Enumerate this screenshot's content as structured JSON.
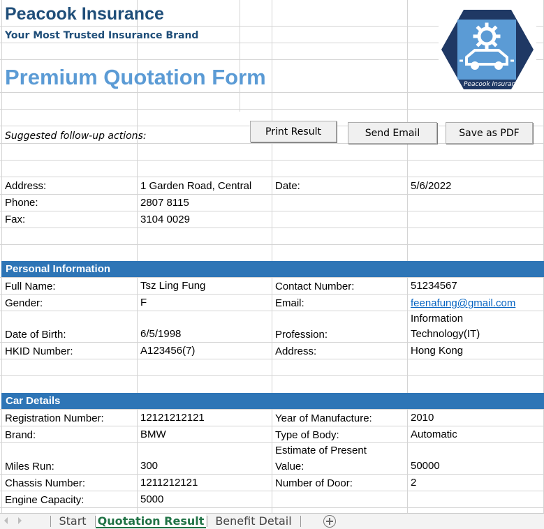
{
  "header": {
    "company": "Peacook Insurance",
    "tagline": "Your Most Trusted Insurance Brand",
    "form_title": "Premium Quotation Form",
    "logo_text": "Peacook Insurance",
    "logo_color": "#1f3864",
    "logo_inner_color": "#5b9bd5"
  },
  "actions": {
    "label": "Suggested follow-up actions:",
    "print": "Print Result",
    "email": "Send Email",
    "pdf": "Save as PDF"
  },
  "company_info": {
    "address_label": "Address:",
    "address": "1 Garden Road, Central",
    "date_label": "Date:",
    "date": "5/6/2022",
    "phone_label": "Phone:",
    "phone": "2807 8115",
    "fax_label": "Fax:",
    "fax": "3104 0029"
  },
  "personal": {
    "title": "Personal Information",
    "full_name_label": "Full Name:",
    "full_name": "Tsz Ling Fung",
    "contact_label": "Contact Number:",
    "contact": "51234567",
    "gender_label": "Gender:",
    "gender": "F",
    "email_label": "Email:",
    "email": "feenafung@gmail.com",
    "dob_label": "Date of Birth:",
    "dob": "6/5/1998",
    "profession_label": "Profession:",
    "profession_line1": "Information",
    "profession_line2": "Technology(IT)",
    "hkid_label": "HKID Number:",
    "hkid": "A123456(7)",
    "address_label": "Address:",
    "address": "Hong Kong"
  },
  "car": {
    "title": "Car Details",
    "reg_label": "Registration Number:",
    "reg": "12121212121",
    "year_label": "Year of Manufacture:",
    "year": "2010",
    "brand_label": "Brand:",
    "brand": "BMW",
    "body_label": "Type of Body:",
    "body": "Automatic",
    "estimate_label_line1": "Estimate of Present",
    "estimate_label_line2": "Value:",
    "estimate": "50000",
    "miles_label": "Miles Run:",
    "miles": "300",
    "chassis_label": "Chassis Number:",
    "chassis": "1211212121",
    "doors_label": "Number of Door:",
    "doors": "2",
    "engine_label": "Engine Capacity:",
    "engine": "5000"
  },
  "tabs": {
    "start": "Start",
    "quotation": "Quotation Result",
    "benefit": "Benefit Detail",
    "add_icon": "plus-circle-icon",
    "active_color": "#217346"
  }
}
